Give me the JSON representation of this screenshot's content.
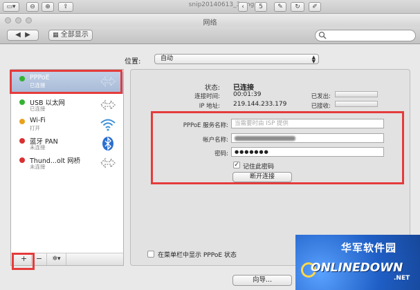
{
  "viewer": {
    "title": "snip20140613_3.png",
    "page_number": "5"
  },
  "window": {
    "title": "网络",
    "show_all_label": "全部显示"
  },
  "location": {
    "label": "位置:",
    "value": "自动"
  },
  "services": [
    {
      "name": "PPPoE",
      "status": "已连接",
      "dot_color": "#34b233",
      "icon": "double-arrow-icon"
    },
    {
      "name": "USB 以太网",
      "status": "已连接",
      "dot_color": "#34b233",
      "icon": "double-arrow-icon"
    },
    {
      "name": "Wi-Fi",
      "status": "打开",
      "dot_color": "#e8a21c",
      "icon": "wifi-icon"
    },
    {
      "name": "蓝牙 PAN",
      "status": "未连接",
      "dot_color": "#d93131",
      "icon": "bluetooth-icon"
    },
    {
      "name": "Thund...olt 网桥",
      "status": "未连接",
      "dot_color": "#d93131",
      "icon": "double-arrow-icon"
    }
  ],
  "sidebar_tools": {
    "add": "+",
    "remove": "−",
    "gear": "✲▾"
  },
  "status": {
    "label": "状态:",
    "value": "已连接",
    "time_label": "连接时间:",
    "time_value": "00:01:39",
    "ip_label": "IP 地址:",
    "ip_value": "219.144.233.179",
    "sent_label": "已发出:",
    "received_label": "已接收:"
  },
  "pppoe": {
    "service_label": "PPPoE 服务名称:",
    "service_placeholder": "当需要时由 ISP 提供",
    "account_label": "帐户名称:",
    "password_label": "密码:",
    "password_value": "●●●●●●●",
    "remember_label": "记住此密码",
    "disconnect_label": "断开连接"
  },
  "menubar_option": "在菜单栏中显示 PPPoE 状态",
  "wizard_label": "向导...",
  "watermark": {
    "top_text": "华军软件园",
    "bottom_text": "ONLINEDOWN",
    "suffix": ".NET"
  },
  "colors": {
    "highlight": "#e53b3b",
    "selection": "#a6b9d6",
    "watermark_bg": "#1f5fc6"
  }
}
